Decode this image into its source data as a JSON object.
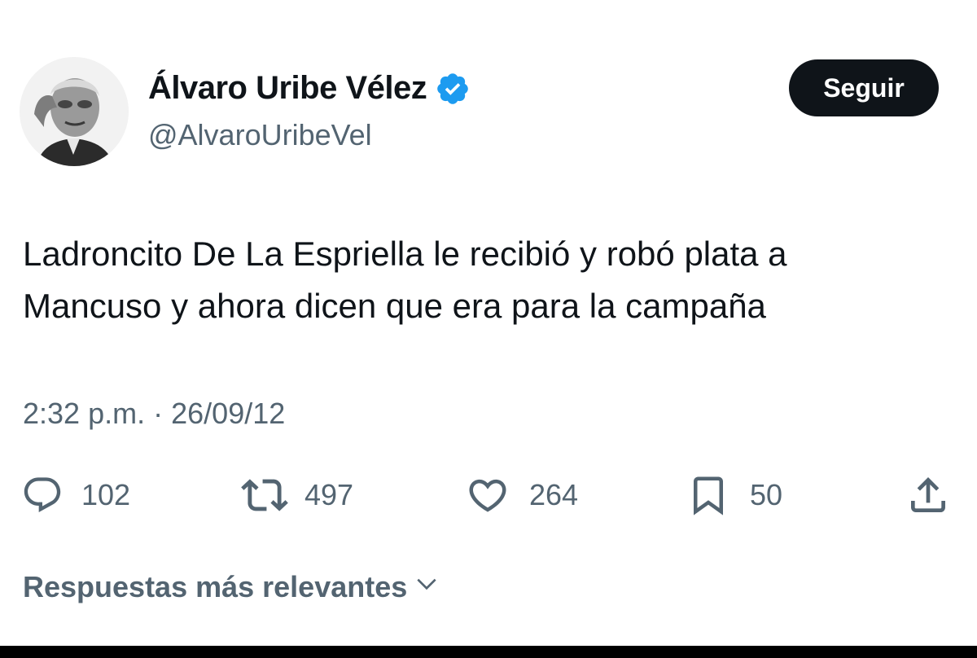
{
  "author": {
    "display_name": "Álvaro Uribe Vélez",
    "handle": "@AlvaroUribeVel",
    "verified_icon": "verified-badge-icon",
    "avatar_icon": "avatar-photo"
  },
  "follow_button": {
    "label": "Seguir"
  },
  "tweet": {
    "text_lines": [
      "Ladroncito De La Espriella le recibió y robó plata a",
      "Mancuso y ahora dicen que era para la campaña"
    ],
    "time": "2:32 p.m.",
    "separator": "·",
    "date": "26/09/12"
  },
  "actions": {
    "reply": {
      "icon": "reply-icon",
      "count": "102"
    },
    "repost": {
      "icon": "repost-icon",
      "count": "497"
    },
    "like": {
      "icon": "heart-icon",
      "count": "264"
    },
    "bookmark": {
      "icon": "bookmark-icon",
      "count": "50"
    },
    "share": {
      "icon": "share-icon"
    }
  },
  "replies_sort": {
    "label": "Respuestas más relevantes",
    "icon": "chevron-down-icon"
  },
  "colors": {
    "text": "#0f1419",
    "secondary": "#536471",
    "verified": "#1d9bf0",
    "button_bg": "#0f1419",
    "background": "#ffffff"
  }
}
